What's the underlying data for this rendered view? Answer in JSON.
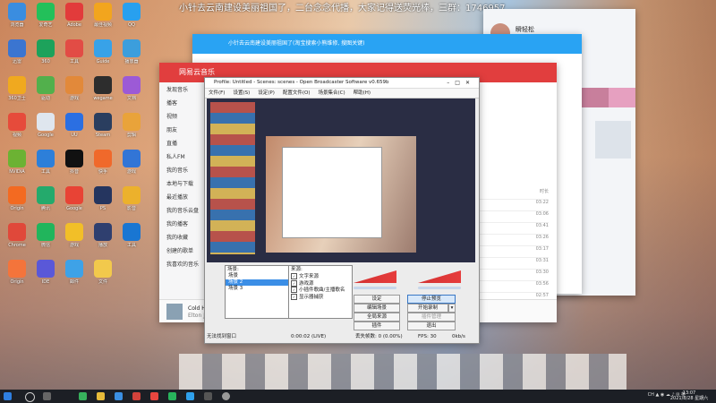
{
  "ticker": "小针去云南建设美丽祖国了，二台念念代播，大家记得送荧光棒，三群：1746957",
  "desktop_icons": [
    {
      "label": "浏览器",
      "color": "#3a8de0"
    },
    {
      "label": "爱奇艺",
      "color": "#23c05a"
    },
    {
      "label": "Adobe",
      "color": "#e23b3b"
    },
    {
      "label": "最佳视频",
      "color": "#f2a51e"
    },
    {
      "label": "QQ",
      "color": "#28a0ef"
    },
    {
      "label": "迅雷",
      "color": "#3b75d0"
    },
    {
      "label": "360",
      "color": "#1da25b"
    },
    {
      "label": "工具",
      "color": "#e24c45"
    },
    {
      "label": "Guide",
      "color": "#38a2e8"
    },
    {
      "label": "播放器",
      "color": "#3c9edc"
    },
    {
      "label": "360卫士",
      "color": "#f0a91f"
    },
    {
      "label": "驱动",
      "color": "#52b04c"
    },
    {
      "label": "游戏",
      "color": "#e2893a"
    },
    {
      "label": "wegame",
      "color": "#2d2d2d"
    },
    {
      "label": "文档",
      "color": "#9c5ad6"
    },
    {
      "label": "视频",
      "color": "#e64b3b"
    },
    {
      "label": "Google",
      "color": "#dfe6ee"
    },
    {
      "label": "UU",
      "color": "#2b6fe2"
    },
    {
      "label": "Steam",
      "color": "#2a3e5f"
    },
    {
      "label": "剪辑",
      "color": "#e9a33a"
    },
    {
      "label": "NVIDIA",
      "color": "#6cb233"
    },
    {
      "label": "工具",
      "color": "#2d7fd9"
    },
    {
      "label": "抖音",
      "color": "#111"
    },
    {
      "label": "快手",
      "color": "#f0692b"
    },
    {
      "label": "游戏",
      "color": "#3275d6"
    },
    {
      "label": "Origin",
      "color": "#f36a21"
    },
    {
      "label": "腾讯",
      "color": "#24aa6c"
    },
    {
      "label": "Google",
      "color": "#e84335"
    },
    {
      "label": "PS",
      "color": "#25355f"
    },
    {
      "label": "影音",
      "color": "#ecb12c"
    },
    {
      "label": "Chrome",
      "color": "#e0483a"
    },
    {
      "label": "微信",
      "color": "#21b55c"
    },
    {
      "label": "游戏",
      "color": "#f2bf28"
    },
    {
      "label": "播放",
      "color": "#2f3f6f"
    },
    {
      "label": "工具",
      "color": "#1976d2"
    },
    {
      "label": "Origin",
      "color": "#f4743b"
    },
    {
      "label": "IDE",
      "color": "#5a58d8"
    },
    {
      "label": "邮件",
      "color": "#3ea2e7"
    },
    {
      "label": "文件",
      "color": "#f2c94c"
    }
  ],
  "qq_window": {
    "name": "瞬轻松",
    "subtitle": "在线"
  },
  "live_window": {
    "title": "小针去云南建设美丽祖国了(淘宝搜索小熊维修, 搜图关键)",
    "room": "1746957"
  },
  "music_window": {
    "title": "网易云音乐",
    "sidebar": [
      "发现音乐",
      "播客",
      "视频",
      "朋友",
      "直播",
      "私人FM",
      "我的音乐",
      "本地与下载",
      "最近播放",
      "我的音乐云盘",
      "我的播客",
      "我的收藏",
      "创建的歌单",
      "我喜欢的音乐"
    ],
    "durations": [
      "时长",
      "03:22",
      "03:06",
      "03:41",
      "03:26",
      "03:17",
      "03:31",
      "03:30",
      "03:56",
      "02:57"
    ],
    "now_playing": "Cold Heart (PNAU Remix)",
    "artist": "Elton John"
  },
  "obs": {
    "title": "Profile: Untitled - Scenes: scenes - Open Broadcaster Software v0.659b",
    "menu": [
      "文件(F)",
      "设置(S)",
      "设定(P)",
      "配置文件(O)",
      "场景集合(C)",
      "帮助(H)"
    ],
    "scenes_header": "场景:",
    "scenes": [
      "场景",
      "场景 2",
      "场景 3"
    ],
    "selected_scene_index": 1,
    "sources_header": "来源:",
    "sources": [
      "文字来源",
      "游戏源",
      "小插件歌曲/主播歌名",
      "显示器捕获"
    ],
    "buttons": {
      "settings": "设定",
      "stop_preview": "停止预览",
      "edit_scene": "编辑场景",
      "start_record": "开始录制",
      "global_source": "全局来源",
      "plugins": "插件管理",
      "plugin": "插件",
      "exit": "退出"
    },
    "status": {
      "left": "无法找到窗口",
      "time": "0:00:02 (LIVE)",
      "dropped": "丢失帧数: 0 (0.00%)",
      "fps": "FPS: 30",
      "kbps": "0kb/s"
    }
  },
  "taskbar": {
    "time": "13:07",
    "date": "2021/8/28 星期六"
  }
}
